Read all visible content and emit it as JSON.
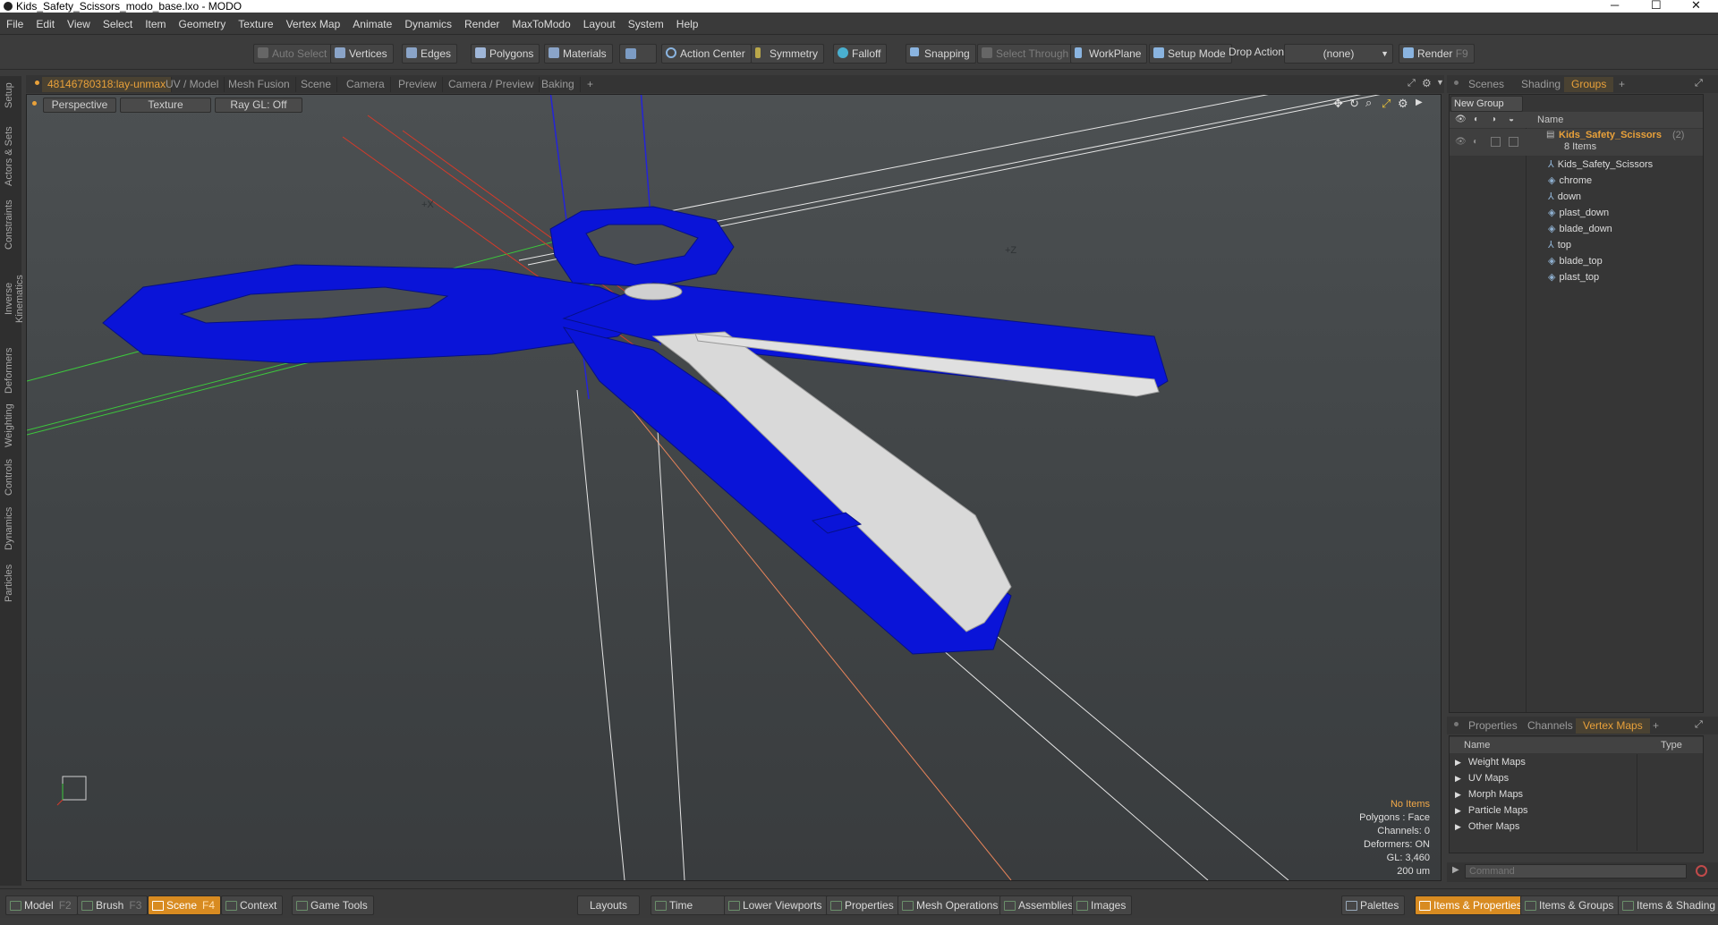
{
  "window": {
    "title": "Kids_Safety_Scissors_modo_base.lxo - MODO",
    "minimize": "─",
    "maximize": "☐",
    "close": "✕"
  },
  "menu": [
    "File",
    "Edit",
    "View",
    "Select",
    "Item",
    "Geometry",
    "Texture",
    "Vertex Map",
    "Animate",
    "Dynamics",
    "Render",
    "MaxToModo",
    "Layout",
    "System",
    "Help"
  ],
  "toolbar": {
    "auto_select": "Auto Select",
    "vertices": "Vertices",
    "edges": "Edges",
    "polygons": "Polygons",
    "materials": "Materials",
    "action_center": "Action Center",
    "symmetry": "Symmetry",
    "falloff": "Falloff",
    "snapping": "Snapping",
    "select_through": "Select Through",
    "workplane": "WorkPlane",
    "setup_mode": "Setup Mode",
    "drop_action": "Drop Action",
    "drop_value": "(none)",
    "render": "Render",
    "render_key": "F9"
  },
  "viewport_tabs": [
    "48146780318:lay-unmax",
    "UV / Model",
    "Mesh Fusion",
    "Scene",
    "Camera",
    "Preview",
    "Camera / Preview",
    "Baking",
    "+"
  ],
  "viewport": {
    "view_mode": "Perspective",
    "shading": "Texture",
    "raygl": "Ray GL: Off",
    "axis_label_x": "+X",
    "axis_label_z": "+Z",
    "stats": {
      "selection": "No Items",
      "polygons": "Polygons : Face",
      "channels": "Channels: 0",
      "deformers": "Deformers: ON",
      "gl": "GL: 3,460",
      "scale": "200 um"
    }
  },
  "left_strip": [
    "Setup",
    "Actors & Sets",
    "Constraints",
    "Inverse Kinematics",
    "Deformers",
    "Weighting",
    "Controls",
    "Dynamics",
    "Particles"
  ],
  "right_tabs": [
    "Scenes",
    "Shading",
    "Groups",
    "+"
  ],
  "groups": {
    "new_group": "New Group",
    "name_header": "Name",
    "group_name": "Kids_Safety_Scissors",
    "group_count": "(2)",
    "item_count": "8 Items",
    "items": [
      "Kids_Safety_Scissors",
      "chrome",
      "down",
      "plast_down",
      "blade_down",
      "top",
      "blade_top",
      "plast_top"
    ]
  },
  "lower_tabs": [
    "Properties",
    "Channels",
    "Vertex Maps",
    "+"
  ],
  "vertex_maps": {
    "name_header": "Name",
    "type_header": "Type",
    "items": [
      "Weight Maps",
      "UV Maps",
      "Morph Maps",
      "Particle Maps",
      "Other Maps"
    ]
  },
  "command_placeholder": "Command",
  "bottom_bar": {
    "model": "Model",
    "model_key": "F2",
    "brush": "Brush",
    "brush_key": "F3",
    "scene": "Scene",
    "scene_key": "F4",
    "context": "Context",
    "game_tools": "Game Tools",
    "layouts": "Layouts",
    "time": "Time",
    "lower_viewports": "Lower Viewports",
    "properties": "Properties",
    "mesh_operations": "Mesh Operations",
    "assemblies": "Assemblies",
    "images": "Images",
    "palettes": "Palettes",
    "items_properties": "Items & Properties",
    "items_groups": "Items & Groups",
    "items_shading": "Items & Shading"
  },
  "colors": {
    "accent": "#e9a13a",
    "scissor_handle": "#0a14d8",
    "blade": "#d9d9d9"
  }
}
